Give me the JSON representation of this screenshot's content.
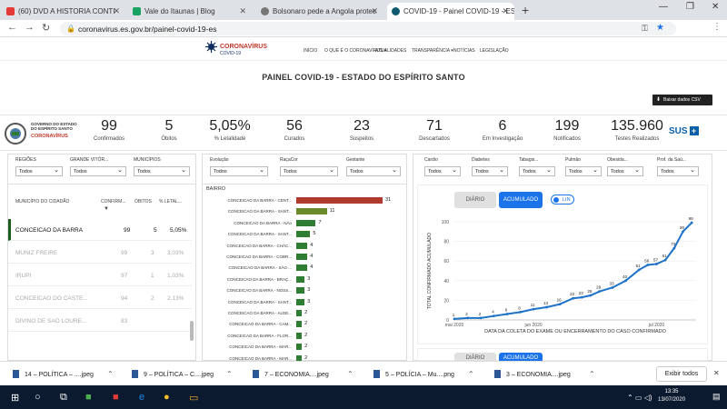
{
  "browser": {
    "tabs": [
      {
        "title": "(60) DVD A HISTORIA CONTI",
        "color": "#e53935"
      },
      {
        "title": "Vale do Itaunas | Blog",
        "color": "#1aa260"
      },
      {
        "title": "Bolsonaro pede a Angola protec",
        "color": "#777777"
      },
      {
        "title": "COVID-19 - Painel COVID-19 - ES",
        "color": "#0e5a6e"
      }
    ],
    "url": "coronavirus.es.gov.br/painel-covid-19-es"
  },
  "site": {
    "logo_title": "CORONAVÍRUS",
    "logo_sub": "COVID-19",
    "menu": [
      "INÍCIO",
      "O QUE É O CORONAVÍRUS ▾",
      "ATUALIDADES",
      "TRANSPARÊNCIA ▾",
      "NOTÍCIAS",
      "LEGISLAÇÃO"
    ]
  },
  "panel_title": "PAINEL COVID-19 - ESTADO DO ESPÍRITO SANTO",
  "csv_button": "Baixar dados CSV",
  "gov_text": [
    "GOVERNO DO ESTADO",
    "DO ESPÍRITO SANTO"
  ],
  "gov_logo_text": "CORONAVÍRUS",
  "stats": [
    {
      "value": "99",
      "label": "Confirmados"
    },
    {
      "value": "5",
      "label": "Óbitos"
    },
    {
      "value": "5,05%",
      "label": "% Letalidade"
    },
    {
      "value": "56",
      "label": "Curados"
    },
    {
      "value": "23",
      "label": "Suspeitos"
    },
    {
      "value": "71",
      "label": "Descartados"
    },
    {
      "value": "6",
      "label": "Em Investigação"
    },
    {
      "value": "199",
      "label": "Notificados"
    },
    {
      "value": "135.960",
      "label": "Testes Realizados"
    }
  ],
  "sus_label": "SUS",
  "filters_left": [
    {
      "label": "REGIÕES",
      "value": "Todos"
    },
    {
      "label": "GRANDE VITÓR...",
      "value": "Todos"
    },
    {
      "label": "MUNICÍPIOS",
      "value": "Todos"
    }
  ],
  "filters_mid": [
    {
      "label": "Evolução",
      "value": "Todos"
    },
    {
      "label": "RaçaCor",
      "value": "Todos"
    },
    {
      "label": "Gestante",
      "value": "Todos"
    }
  ],
  "filters_right": [
    {
      "label": "Cardio",
      "value": "Todos"
    },
    {
      "label": "Diabetes",
      "value": "Todos"
    },
    {
      "label": "Tabagis...",
      "value": "Todos"
    },
    {
      "label": "Pulmão",
      "value": "Todos"
    },
    {
      "label": "Obesida...",
      "value": "Todos"
    },
    {
      "label": "Prof. da Saú...",
      "value": "Todos"
    }
  ],
  "city_table": {
    "headers": [
      "MUNICÍPIO DO CIDADÃO",
      "CONFIRM...",
      "ÓBITOS",
      "% LETAL..."
    ],
    "rows": [
      {
        "city": "CONCEICAO DA BARRA",
        "conf": "99",
        "obitos": "5",
        "letal": "5,05%"
      },
      {
        "city": "MUNIZ FREIRE",
        "conf": "99",
        "obitos": "3",
        "letal": "3,03%"
      },
      {
        "city": "IRUPI",
        "conf": "97",
        "obitos": "1",
        "letal": "1,03%"
      },
      {
        "city": "CONCEICAO DO CASTE...",
        "conf": "94",
        "obitos": "2",
        "letal": "2,13%"
      },
      {
        "city": "DIVINO DE SAO LOURE...",
        "conf": "83",
        "obitos": "",
        "letal": ""
      }
    ]
  },
  "bairro": {
    "title": "BAIRRO",
    "items": [
      {
        "label": "CONCEICAO DA BARRA - CENT...",
        "value": 31,
        "color": "#b03a2e"
      },
      {
        "label": "CONCEICAO DA BARRA - SANT...",
        "value": 11,
        "color": "#6a8a2a"
      },
      {
        "label": "CONCEICAO DA BARRA - NÃo",
        "value": 7,
        "color": "#2e7d32"
      },
      {
        "label": "CONCEICAO DA BARRA - SANT...",
        "value": 5,
        "color": "#2e7d32"
      },
      {
        "label": "CONCEICAO DA BARRA - CHÁC...",
        "value": 4,
        "color": "#2e7d32"
      },
      {
        "label": "CONCEICAO DA BARRA - COBR...",
        "value": 4,
        "color": "#2e7d32"
      },
      {
        "label": "CONCEICAO DA BARRA - SÃO ...",
        "value": 4,
        "color": "#2e7d32"
      },
      {
        "label": "CONCEICAO DA BARRA - BRAÇ...",
        "value": 3,
        "color": "#2e7d32"
      },
      {
        "label": "CONCEICAO DA BARRA - NOSS...",
        "value": 3,
        "color": "#2e7d32"
      },
      {
        "label": "CONCEICAO DA BARRA - SANT...",
        "value": 3,
        "color": "#2e7d32"
      },
      {
        "label": "CONCEICAO DA BARRA - ALDE...",
        "value": 2,
        "color": "#2e7d32"
      },
      {
        "label": "CONCEICAO DA BARRA - CAM...",
        "value": 2,
        "color": "#2e7d32"
      },
      {
        "label": "CONCEICAO DA BARRA - FLOR...",
        "value": 2,
        "color": "#2e7d32"
      },
      {
        "label": "CONCEICAO DA BARRA - MAR...",
        "value": 2,
        "color": "#2e7d32"
      },
      {
        "label": "CONCEICAO DA BARRA - MAR...",
        "value": 2,
        "color": "#2e7d32"
      }
    ]
  },
  "chart_data": {
    "type": "line",
    "toggle": [
      "DIÁRIO",
      "ACUMULADO"
    ],
    "switch_label": "LIN",
    "ylabel": "TOTAL CONFIRMADO ACUMULADO",
    "xlabel": "DATA DA COLETA DO EXAME OU ENCERRAMENTO DO CASO CONFIRMADO",
    "xticks": [
      "mai 2020",
      "jun 2020",
      "jul 2020"
    ],
    "yticks": [
      0,
      20,
      40,
      60,
      80,
      100
    ],
    "ylim": [
      0,
      100
    ],
    "x": [
      "2020-05-20",
      "2020-05-23",
      "2020-05-26",
      "2020-05-29",
      "2020-06-01",
      "2020-06-04",
      "2020-06-07",
      "2020-06-10",
      "2020-06-13",
      "2020-06-16",
      "2020-06-18",
      "2020-06-20",
      "2020-06-22",
      "2020-06-25",
      "2020-06-28",
      "2020-07-01",
      "2020-07-03",
      "2020-07-05",
      "2020-07-07",
      "2020-07-09",
      "2020-07-11",
      "2020-07-13"
    ],
    "values": [
      1,
      2,
      2,
      4,
      6,
      8,
      11,
      13,
      16,
      22,
      23,
      25,
      29,
      33,
      40,
      51,
      56,
      57,
      61,
      73,
      90,
      99
    ],
    "labeled": [
      1,
      2,
      4,
      6,
      8,
      11,
      13,
      16,
      22,
      23,
      25,
      29,
      33,
      40,
      51,
      56,
      57,
      61,
      73,
      90,
      99
    ]
  },
  "downloads": [
    {
      "name": "14 – POLÍTICA – ....jpeg"
    },
    {
      "name": "9 – POLÍTICA – C....jpeg"
    },
    {
      "name": "7 – ECONOMIA....jpeg"
    },
    {
      "name": "5 – POLÍCIA – Mu....png"
    },
    {
      "name": "3 – ECONOMIA....jpeg"
    }
  ],
  "show_all": "Exibir todos",
  "clock": {
    "time": "13:35",
    "date": "13/07/2020"
  }
}
